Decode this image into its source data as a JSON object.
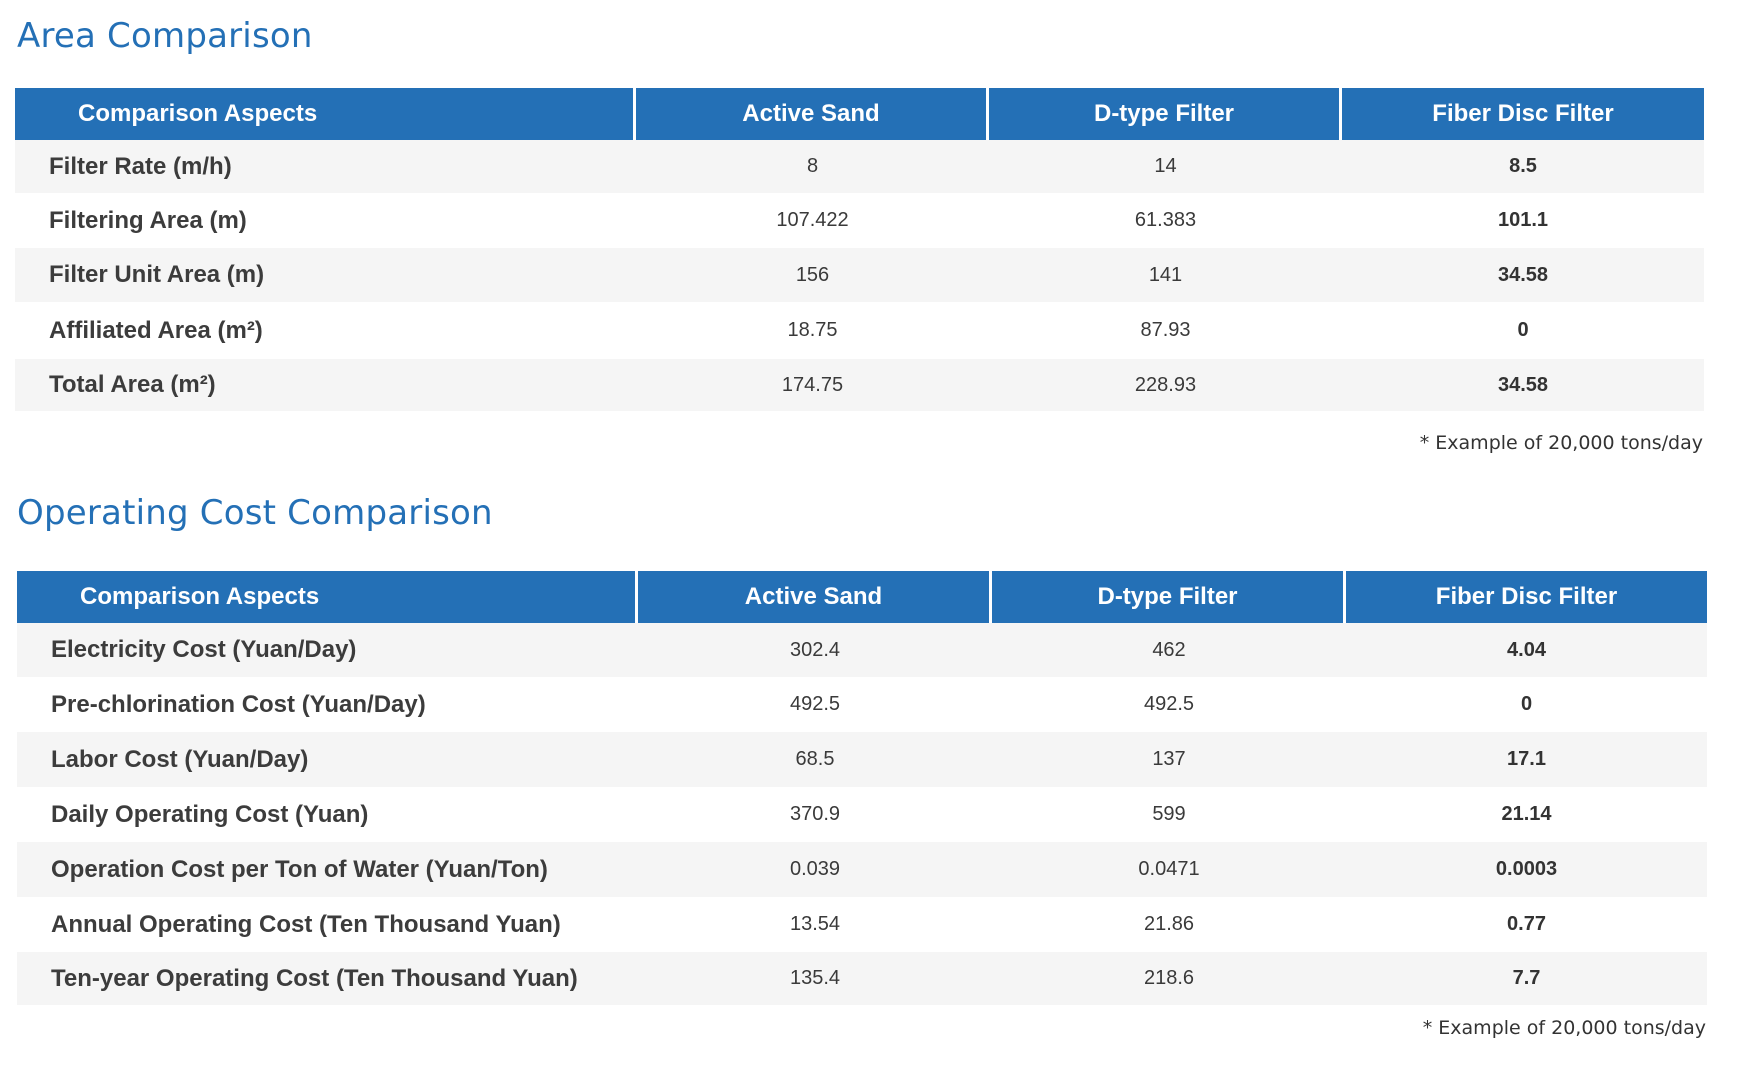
{
  "area": {
    "title": "Area Comparison",
    "headers": [
      "Comparison Aspects",
      "Active Sand",
      "D-type Filter",
      "Fiber Disc Filter"
    ],
    "rows": [
      {
        "label": "Filter Rate (m/h)",
        "active_sand": "8",
        "d_type": "14",
        "fiber_disc": "8.5"
      },
      {
        "label": "Filtering Area (m)",
        "active_sand": "107.422",
        "d_type": "61.383",
        "fiber_disc": "101.1"
      },
      {
        "label": "Filter Unit Area (m)",
        "active_sand": "156",
        "d_type": "141",
        "fiber_disc": "34.58"
      },
      {
        "label": "Affiliated Area (m²)",
        "active_sand": "18.75",
        "d_type": "87.93",
        "fiber_disc": "0"
      },
      {
        "label": "Total Area (m²)",
        "active_sand": "174.75",
        "d_type": "228.93",
        "fiber_disc": "34.58"
      }
    ],
    "note": "* Example of 20,000 tons/day"
  },
  "cost": {
    "title": "Operating Cost Comparison",
    "headers": [
      "Comparison Aspects",
      "Active Sand",
      "D-type Filter",
      "Fiber Disc Filter"
    ],
    "rows": [
      {
        "label": "Electricity Cost (Yuan/Day)",
        "active_sand": "302.4",
        "d_type": "462",
        "fiber_disc": "4.04"
      },
      {
        "label": "Pre-chlorination Cost (Yuan/Day)",
        "active_sand": "492.5",
        "d_type": "492.5",
        "fiber_disc": "0"
      },
      {
        "label": "Labor Cost (Yuan/Day)",
        "active_sand": "68.5",
        "d_type": "137",
        "fiber_disc": "17.1"
      },
      {
        "label": "Daily Operating Cost (Yuan)",
        "active_sand": "370.9",
        "d_type": "599",
        "fiber_disc": "21.14"
      },
      {
        "label": "Operation Cost per Ton of Water (Yuan/Ton)",
        "active_sand": "0.039",
        "d_type": "0.0471",
        "fiber_disc": "0.0003"
      },
      {
        "label": "Annual Operating Cost (Ten Thousand Yuan)",
        "active_sand": "13.54",
        "d_type": "21.86",
        "fiber_disc": "0.77"
      },
      {
        "label": "Ten-year Operating Cost (Ten Thousand Yuan)",
        "active_sand": "135.4",
        "d_type": "218.6",
        "fiber_disc": "7.7"
      }
    ],
    "note": "*  Example of 20,000 tons/day"
  },
  "colors": {
    "accent": "#2470b6",
    "row_shade": "#f5f5f5"
  }
}
